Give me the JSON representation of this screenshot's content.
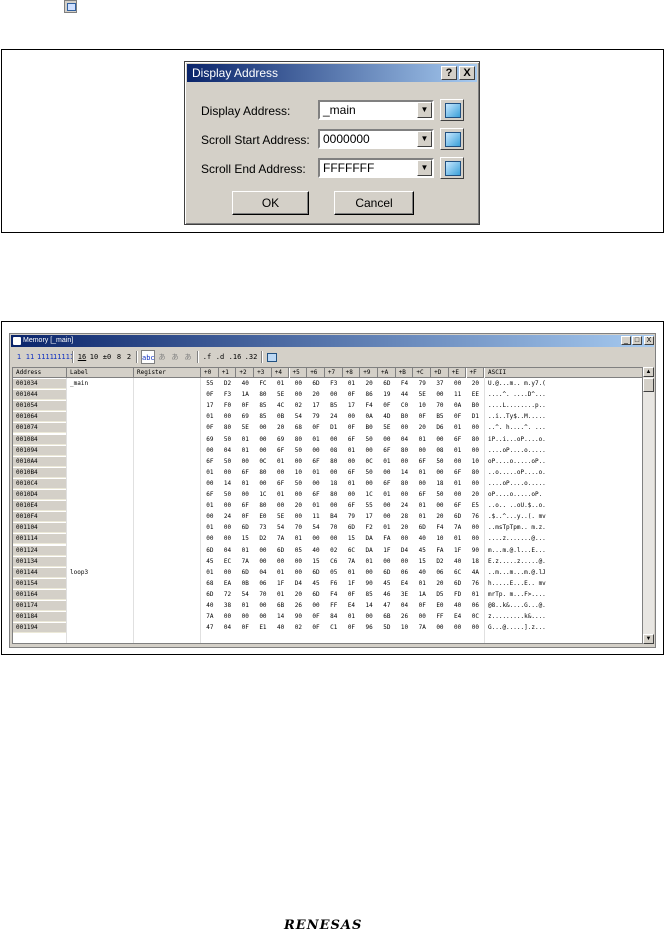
{
  "dialog": {
    "title": "Display Address",
    "help_button": "?",
    "close_button": "X",
    "fields": [
      {
        "label": "Display Address:",
        "value": "_main"
      },
      {
        "label": "Scroll Start Address:",
        "value": "0000000"
      },
      {
        "label": "Scroll End Address:",
        "value": "FFFFFFF"
      }
    ],
    "ok_label": "OK",
    "cancel_label": "Cancel"
  },
  "memory_window": {
    "title": "Memory [_main]",
    "minimize": "_",
    "maximize": "□",
    "close": "X",
    "toolbar": [
      "1",
      "11",
      "1111",
      "11111",
      "16",
      "10",
      "±0",
      "8",
      "2",
      "abc",
      "あ",
      "あ",
      "あ",
      ".f",
      ".d",
      ".16",
      ".32"
    ],
    "headers": {
      "address": "Address",
      "label": "Label",
      "register": "Register",
      "offsets": [
        "+0",
        "+1",
        "+2",
        "+3",
        "+4",
        "+5",
        "+6",
        "+7",
        "+8",
        "+9",
        "+A",
        "+B",
        "+C",
        "+D",
        "+E",
        "+F"
      ],
      "ascii": "ASCII"
    },
    "rows": [
      {
        "address": "001034",
        "label": "_main",
        "register": "",
        "bytes": [
          "55",
          "D2",
          "40",
          "FC",
          "01",
          "00",
          "6D",
          "F3",
          "01",
          "20",
          "6D",
          "F4",
          "79",
          "37",
          "00",
          "20"
        ],
        "ascii": "U.@...m.. m.y7.("
      },
      {
        "address": "001044",
        "label": "",
        "register": "",
        "bytes": [
          "0F",
          "F3",
          "1A",
          "80",
          "5E",
          "00",
          "20",
          "00",
          "0F",
          "86",
          "19",
          "44",
          "5E",
          "00",
          "11",
          "EE"
        ],
        "ascii": "....^. ....D^..."
      },
      {
        "address": "001054",
        "label": "",
        "register": "",
        "bytes": [
          "17",
          "F0",
          "0F",
          "85",
          "4C",
          "02",
          "17",
          "B5",
          "17",
          "F4",
          "0F",
          "C0",
          "10",
          "70",
          "0A",
          "B0"
        ],
        "ascii": "....L........p.."
      },
      {
        "address": "001064",
        "label": "",
        "register": "",
        "bytes": [
          "01",
          "00",
          "69",
          "85",
          "0B",
          "54",
          "79",
          "24",
          "00",
          "0A",
          "4D",
          "B0",
          "0F",
          "B5",
          "0F",
          "D1"
        ],
        "ascii": "..i..Ty$..M....."
      },
      {
        "address": "001074",
        "label": "",
        "register": "",
        "bytes": [
          "0F",
          "80",
          "5E",
          "00",
          "20",
          "68",
          "0F",
          "D1",
          "0F",
          "B0",
          "5E",
          "00",
          "20",
          "D6",
          "01",
          "00"
        ],
        "ascii": "..^. h....^. ..."
      },
      {
        "address": "001084",
        "label": "",
        "register": "",
        "bytes": [
          "69",
          "50",
          "01",
          "00",
          "69",
          "80",
          "01",
          "00",
          "6F",
          "50",
          "00",
          "04",
          "01",
          "00",
          "6F",
          "80"
        ],
        "ascii": "iP..i...oP....o."
      },
      {
        "address": "001094",
        "label": "",
        "register": "",
        "bytes": [
          "00",
          "04",
          "01",
          "00",
          "6F",
          "50",
          "00",
          "08",
          "01",
          "00",
          "6F",
          "80",
          "00",
          "08",
          "01",
          "00"
        ],
        "ascii": "....oP....o....."
      },
      {
        "address": "0010A4",
        "label": "",
        "register": "",
        "bytes": [
          "6F",
          "50",
          "00",
          "0C",
          "01",
          "00",
          "6F",
          "80",
          "00",
          "0C",
          "01",
          "00",
          "6F",
          "50",
          "00",
          "10"
        ],
        "ascii": "oP....o.....oP.."
      },
      {
        "address": "0010B4",
        "label": "",
        "register": "",
        "bytes": [
          "01",
          "00",
          "6F",
          "80",
          "00",
          "10",
          "01",
          "00",
          "6F",
          "50",
          "00",
          "14",
          "01",
          "00",
          "6F",
          "80"
        ],
        "ascii": "..o.....oP....o."
      },
      {
        "address": "0010C4",
        "label": "",
        "register": "",
        "bytes": [
          "00",
          "14",
          "01",
          "00",
          "6F",
          "50",
          "00",
          "18",
          "01",
          "00",
          "6F",
          "80",
          "00",
          "18",
          "01",
          "00"
        ],
        "ascii": "....oP....o....."
      },
      {
        "address": "0010D4",
        "label": "",
        "register": "",
        "bytes": [
          "6F",
          "50",
          "00",
          "1C",
          "01",
          "00",
          "6F",
          "80",
          "00",
          "1C",
          "01",
          "00",
          "6F",
          "50",
          "00",
          "20"
        ],
        "ascii": "oP....o.....oP. "
      },
      {
        "address": "0010E4",
        "label": "",
        "register": "",
        "bytes": [
          "01",
          "00",
          "6F",
          "80",
          "00",
          "20",
          "01",
          "00",
          "6F",
          "55",
          "00",
          "24",
          "01",
          "00",
          "6F",
          "E5"
        ],
        "ascii": "..o.. ..oU.$..o."
      },
      {
        "address": "0010F4",
        "label": "",
        "register": "",
        "bytes": [
          "00",
          "24",
          "0F",
          "E0",
          "5E",
          "00",
          "11",
          "B4",
          "79",
          "17",
          "00",
          "28",
          "01",
          "20",
          "6D",
          "76"
        ],
        "ascii": ".$..^...y..(. mv"
      },
      {
        "address": "001104",
        "label": "",
        "register": "",
        "bytes": [
          "01",
          "00",
          "6D",
          "73",
          "54",
          "70",
          "54",
          "70",
          "6D",
          "F2",
          "01",
          "20",
          "6D",
          "F4",
          "7A",
          "00"
        ],
        "ascii": "..msTpTpm.. m.z."
      },
      {
        "address": "001114",
        "label": "",
        "register": "",
        "bytes": [
          "00",
          "00",
          "15",
          "D2",
          "7A",
          "01",
          "00",
          "00",
          "15",
          "DA",
          "FA",
          "00",
          "40",
          "10",
          "01",
          "00"
        ],
        "ascii": "....z.......@..."
      },
      {
        "address": "001124",
        "label": "",
        "register": "",
        "bytes": [
          "6D",
          "04",
          "01",
          "00",
          "6D",
          "05",
          "40",
          "02",
          "6C",
          "DA",
          "1F",
          "D4",
          "45",
          "FA",
          "1F",
          "90"
        ],
        "ascii": "m...m.@.l...E..."
      },
      {
        "address": "001134",
        "label": "",
        "register": "",
        "bytes": [
          "45",
          "EC",
          "7A",
          "00",
          "00",
          "00",
          "15",
          "C6",
          "7A",
          "01",
          "00",
          "00",
          "15",
          "D2",
          "40",
          "18"
        ],
        "ascii": "E.z.....z.....@."
      },
      {
        "address": "001144",
        "label": "loop3",
        "register": "",
        "bytes": [
          "01",
          "00",
          "6D",
          "04",
          "01",
          "00",
          "6D",
          "05",
          "01",
          "00",
          "6D",
          "06",
          "40",
          "06",
          "6C",
          "4A"
        ],
        "ascii": "..m...m...m.@.lJ"
      },
      {
        "address": "001154",
        "label": "",
        "register": "",
        "bytes": [
          "68",
          "EA",
          "0B",
          "06",
          "1F",
          "D4",
          "45",
          "F6",
          "1F",
          "90",
          "45",
          "E4",
          "01",
          "20",
          "6D",
          "76"
        ],
        "ascii": "h.....E...E.. mv"
      },
      {
        "address": "001164",
        "label": "",
        "register": "",
        "bytes": [
          "6D",
          "72",
          "54",
          "70",
          "01",
          "20",
          "6D",
          "F4",
          "0F",
          "85",
          "46",
          "3E",
          "1A",
          "D5",
          "FD",
          "01"
        ],
        "ascii": "mrTp. m...F>...."
      },
      {
        "address": "001174",
        "label": "",
        "register": "",
        "bytes": [
          "40",
          "38",
          "01",
          "00",
          "6B",
          "26",
          "00",
          "FF",
          "E4",
          "14",
          "47",
          "04",
          "0F",
          "E0",
          "40",
          "06"
        ],
        "ascii": "@8..k&....G...@."
      },
      {
        "address": "001184",
        "label": "",
        "register": "",
        "bytes": [
          "7A",
          "00",
          "00",
          "00",
          "14",
          "90",
          "0F",
          "84",
          "01",
          "00",
          "6B",
          "26",
          "00",
          "FF",
          "E4",
          "0C"
        ],
        "ascii": "z.........k&...."
      },
      {
        "address": "001194",
        "label": "",
        "register": "",
        "bytes": [
          "47",
          "04",
          "0F",
          "E1",
          "40",
          "02",
          "0F",
          "C1",
          "0F",
          "96",
          "5D",
          "10",
          "7A",
          "00",
          "00",
          "00"
        ],
        "ascii": "G...@.....].z..."
      }
    ]
  },
  "logo": "RENESAS"
}
